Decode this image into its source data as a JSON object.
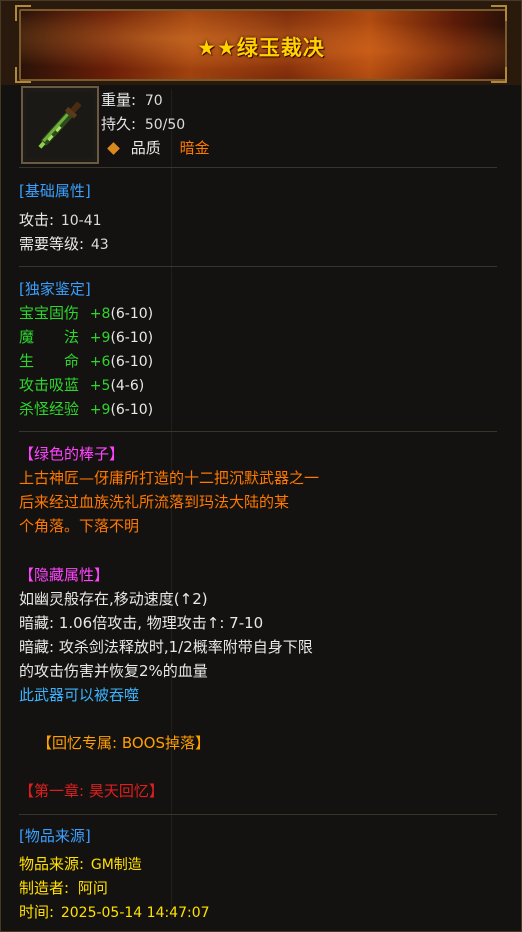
{
  "item": {
    "title": "★★绿玉裁决",
    "icon": "jade-sword-icon",
    "weight_label": "重量:",
    "weight_value": "70",
    "durability_label": "持久:",
    "durability_value": "50/50",
    "quality_label": "品质",
    "quality_value": "暗金"
  },
  "basic": {
    "header": "[基础属性]",
    "attack_label": "攻击:",
    "attack_value": "10-41",
    "level_label": "需要等级:",
    "level_value": "43"
  },
  "exclusive": {
    "header": "[独家鉴定]",
    "stats": [
      {
        "name": "宝宝固伤",
        "bonus": "+8",
        "range": "(6-10)"
      },
      {
        "name": "魔　　法",
        "bonus": "+9",
        "range": "(6-10)"
      },
      {
        "name": "生　　命",
        "bonus": "+6",
        "range": "(6-10)"
      },
      {
        "name": "攻击吸蓝",
        "bonus": "+5",
        "range": "(4-6)"
      },
      {
        "name": "杀怪经验",
        "bonus": "+9",
        "range": "(6-10)"
      }
    ]
  },
  "lore": {
    "header": "【绿色的棒子】",
    "lines": [
      "上古神匠—伢庸所打造的十二把沉默武器之一",
      "后来经过血族洗礼所流落到玛法大陆的某",
      "个角落。下落不明"
    ]
  },
  "hidden": {
    "header": "【隐藏属性】",
    "line1": "如幽灵般存在,移动速度(↑2)",
    "line2": "暗藏: 1.06倍攻击, 物理攻击↑: 7-10",
    "line3": "暗藏: 攻杀剑法释放时,1/2概率附带自身下限",
    "line4": "的攻击伤害并恢复2%的血量",
    "devour": "此武器可以被吞噬"
  },
  "memory": {
    "exclusive": "【回忆专属: BOOS掉落】",
    "chapter": "【第一章: 昊天回忆】"
  },
  "source": {
    "header": "[物品来源]",
    "origin_label": "物品来源:",
    "origin_value": "GM制造",
    "maker_label": "制造者:",
    "maker_value": "阿问",
    "time_label": "时间:",
    "time_value": "2025-05-14 14:47:07"
  },
  "colors": {
    "title": "#ffd200",
    "section": "#3aa0ff",
    "stat": "#2ed52e",
    "lore": "#ff7800",
    "magenta": "#ff44ff",
    "red": "#e01e1e"
  }
}
